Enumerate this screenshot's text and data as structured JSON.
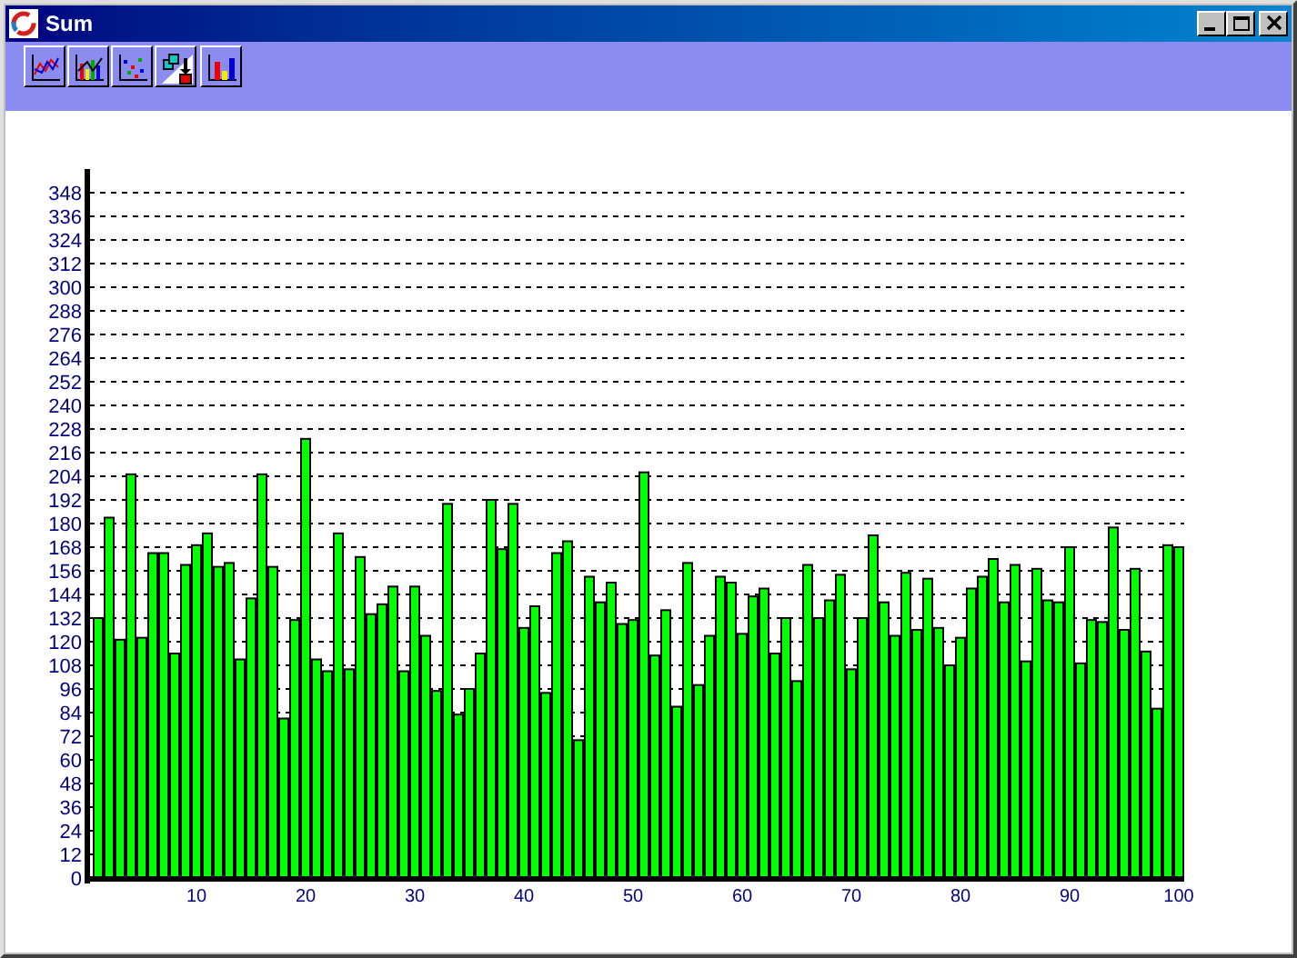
{
  "window": {
    "title": "Sum"
  },
  "toolbar": {
    "buttons": [
      {
        "kind": "line"
      },
      {
        "kind": "bar3"
      },
      {
        "kind": "scatter"
      },
      {
        "kind": "export"
      },
      {
        "kind": "bars"
      }
    ]
  },
  "chart_data": {
    "type": "bar",
    "x": [
      1,
      2,
      3,
      4,
      5,
      6,
      7,
      8,
      9,
      10,
      11,
      12,
      13,
      14,
      15,
      16,
      17,
      18,
      19,
      20,
      21,
      22,
      23,
      24,
      25,
      26,
      27,
      28,
      29,
      30,
      31,
      32,
      33,
      34,
      35,
      36,
      37,
      38,
      39,
      40,
      41,
      42,
      43,
      44,
      45,
      46,
      47,
      48,
      49,
      50,
      51,
      52,
      53,
      54,
      55,
      56,
      57,
      58,
      59,
      60,
      61,
      62,
      63,
      64,
      65,
      66,
      67,
      68,
      69,
      70,
      71,
      72,
      73,
      74,
      75,
      76,
      77,
      78,
      79,
      80,
      81,
      82,
      83,
      84,
      85,
      86,
      87,
      88,
      89,
      90,
      91,
      92,
      93,
      94,
      95,
      96,
      97,
      98,
      99,
      100
    ],
    "series": [
      {
        "color": "#00ff00",
        "values": [
          132,
          183,
          121,
          205,
          122,
          165,
          165,
          114,
          159,
          169,
          175,
          158,
          160,
          111,
          142,
          205,
          158,
          81,
          131,
          223,
          111,
          105,
          175,
          106,
          163,
          134,
          139,
          148,
          105,
          148,
          123,
          95,
          190,
          83,
          96,
          114,
          192,
          167,
          190,
          127,
          138,
          94,
          165,
          171,
          70,
          153,
          140,
          150,
          129,
          131,
          206,
          113,
          136,
          87,
          160,
          98,
          123,
          153,
          150,
          124,
          143,
          147,
          114,
          132,
          100,
          159,
          132,
          141,
          154,
          106,
          132,
          174,
          140,
          123,
          155,
          126,
          152,
          127,
          108,
          122,
          147,
          153,
          162,
          140,
          159,
          110,
          157,
          141,
          140,
          168,
          109,
          131,
          130,
          178,
          126,
          157,
          115,
          86,
          169,
          168
        ]
      }
    ],
    "xlim": [
      0,
      100.5
    ],
    "ylim": [
      0,
      348
    ],
    "grid": true,
    "xticks": [
      10,
      20,
      30,
      40,
      50,
      60,
      70,
      80,
      90,
      100
    ],
    "yticks": [
      0,
      12,
      24,
      36,
      48,
      60,
      72,
      84,
      96,
      108,
      120,
      132,
      144,
      156,
      168,
      180,
      192,
      204,
      216,
      228,
      240,
      252,
      264,
      276,
      288,
      300,
      312,
      324,
      336,
      348
    ]
  }
}
